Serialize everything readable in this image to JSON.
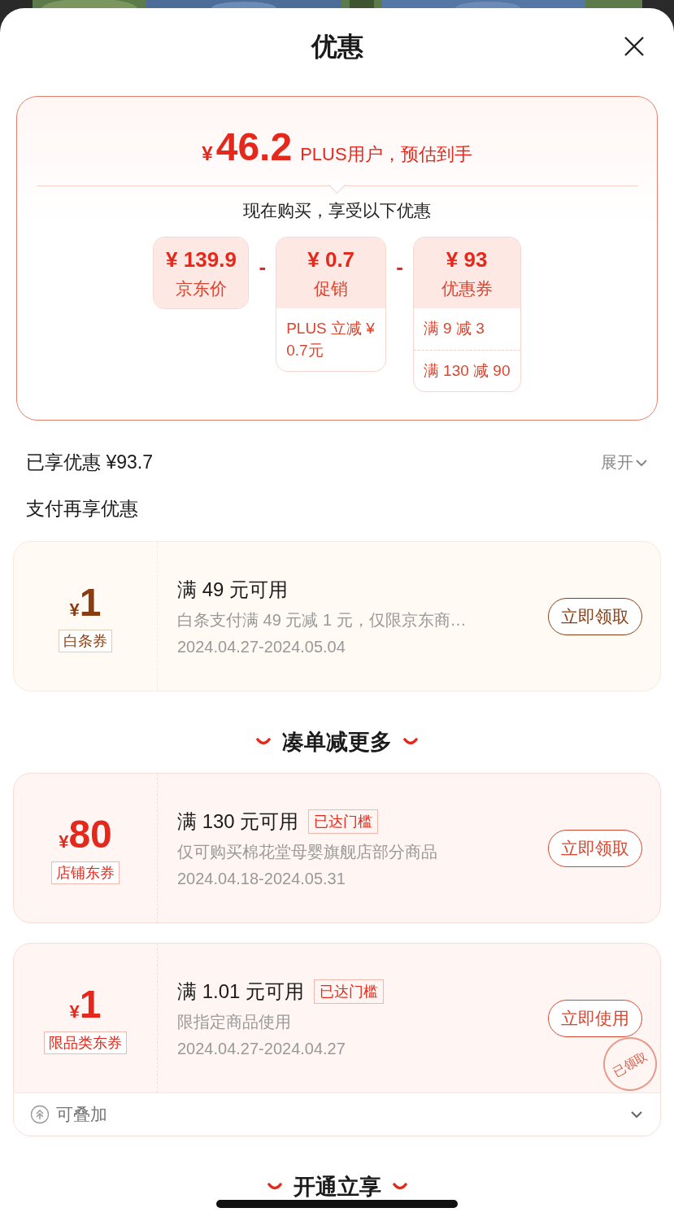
{
  "sheet": {
    "title": "优惠"
  },
  "summary": {
    "currency": "¥",
    "price": "46.2",
    "note": "PLUS用户，预估到手",
    "subtitle": "现在购买，享受以下优惠",
    "breakdown": [
      {
        "amount": "¥ 139.9",
        "label": "京东价"
      },
      {
        "operator": "-",
        "amount": "¥ 0.7",
        "label": "促销",
        "details": [
          "PLUS 立减 ¥ 0.7元"
        ]
      },
      {
        "operator": "-",
        "amount": "¥ 93",
        "label": "优惠券",
        "details": [
          "满 9 减 3",
          "满 130 减 90"
        ]
      }
    ]
  },
  "enjoyed": {
    "label": "已享优惠 ¥93.7",
    "toggle": "展开"
  },
  "payment_heading": "支付再享优惠",
  "sections": [
    {
      "coupons": [
        {
          "kind": "payment",
          "currency": "¥",
          "amount": "1",
          "tag": "白条券",
          "title": "满 49 元可用",
          "description": "白条支付满 49 元减 1 元，仅限京东商…",
          "dates": "2024.04.27-2024.05.04",
          "action": "立即领取"
        }
      ]
    },
    {
      "heading": "凑单减更多",
      "coupons": [
        {
          "kind": "shop",
          "currency": "¥",
          "amount": "80",
          "tag": "店铺东券",
          "title": "满 130 元可用",
          "badge": "已达门槛",
          "description": "仅可购买棉花堂母婴旗舰店部分商品",
          "dates": "2024.04.18-2024.05.31",
          "action": "立即领取"
        },
        {
          "kind": "shop",
          "currency": "¥",
          "amount": "1",
          "tag": "限品类东券",
          "title": "满 1.01 元可用",
          "badge": "已达门槛",
          "description": "限指定商品使用",
          "dates": "2024.04.27-2024.04.27",
          "action": "立即使用",
          "stamp": "已领取",
          "footer": "可叠加"
        }
      ]
    },
    {
      "heading": "开通立享"
    }
  ]
}
